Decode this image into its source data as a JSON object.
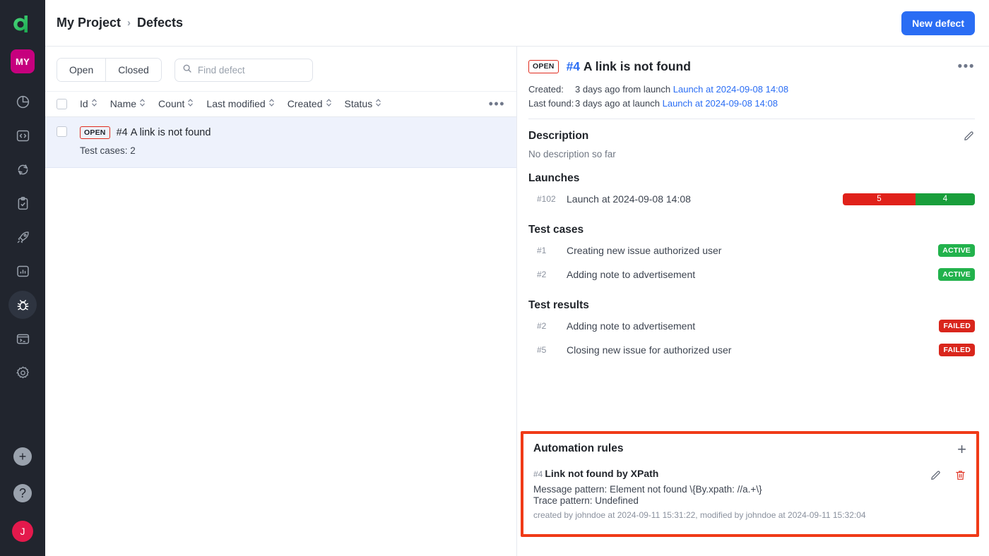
{
  "sidebar": {
    "logo": "allure-logo",
    "project_badge": "MY",
    "nav_items": [
      {
        "name": "dashboard",
        "icon": "pie-chart-icon",
        "active": false
      },
      {
        "name": "code",
        "icon": "code-brackets-icon",
        "active": false
      },
      {
        "name": "sync",
        "icon": "refresh-cycle-icon",
        "active": false
      },
      {
        "name": "test-plan",
        "icon": "clipboard-check-icon",
        "active": false
      },
      {
        "name": "launches",
        "icon": "rocket-icon",
        "active": false
      },
      {
        "name": "analytics",
        "icon": "bar-chart-icon",
        "active": false
      },
      {
        "name": "defects",
        "icon": "bug-icon",
        "active": true
      },
      {
        "name": "console",
        "icon": "terminal-icon",
        "active": false
      },
      {
        "name": "settings",
        "icon": "gear-icon",
        "active": false
      }
    ],
    "add_label": "+",
    "help_label": "?",
    "avatar_initial": "J"
  },
  "topbar": {
    "breadcrumb": {
      "project": "My Project",
      "separator": "›",
      "current": "Defects"
    },
    "new_defect_label": "New defect"
  },
  "list_pane": {
    "tabs": [
      {
        "label": "Open",
        "selected": true
      },
      {
        "label": "Closed",
        "selected": false
      }
    ],
    "search": {
      "placeholder": "Find defect",
      "value": "",
      "icon": "search-icon"
    },
    "columns": [
      {
        "label": "Id"
      },
      {
        "label": "Name"
      },
      {
        "label": "Count"
      },
      {
        "label": "Last modified"
      },
      {
        "label": "Created"
      },
      {
        "label": "Status"
      }
    ],
    "more_label": "•••",
    "rows": [
      {
        "status_tag": "OPEN",
        "id": "#4",
        "title": "A link is not found",
        "subtitle": "Test cases: 2"
      }
    ]
  },
  "detail": {
    "status_tag": "OPEN",
    "id": "#4",
    "title": "A link is not found",
    "more_label": "•••",
    "meta": {
      "created_label": "Created:",
      "created_value": "3 days ago from launch",
      "created_link": "Launch at 2024-09-08 14:08",
      "last_found_label": "Last found:",
      "last_found_value": "3 days ago at launch",
      "last_found_link": "Launch at 2024-09-08 14:08"
    },
    "description": {
      "title": "Description",
      "text": "No description so far",
      "edit_icon": "pencil-icon"
    },
    "launches": {
      "title": "Launches",
      "items": [
        {
          "id": "#102",
          "name": "Launch at 2024-09-08 14:08",
          "failed_count": "5",
          "passed_count": "4",
          "failed_color": "#e0211a",
          "passed_color": "#199e3b"
        }
      ]
    },
    "test_cases": {
      "title": "Test cases",
      "items": [
        {
          "id": "#1",
          "name": "Creating new issue authorized user",
          "status": "ACTIVE"
        },
        {
          "id": "#2",
          "name": "Adding note to advertisement",
          "status": "ACTIVE"
        }
      ]
    },
    "test_results": {
      "title": "Test results",
      "items": [
        {
          "id": "#2",
          "name": "Adding note to advertisement",
          "status": "FAILED"
        },
        {
          "id": "#5",
          "name": "Closing new issue for authorized user",
          "status": "FAILED"
        }
      ]
    },
    "automation_rules": {
      "title": "Automation rules",
      "add_label": "+",
      "highlight_color": "#f03a17",
      "rule": {
        "id": "#4",
        "name": "Link not found by XPath",
        "message_pattern": "Message pattern: Element not found \\{By.xpath: //a.+\\}",
        "trace_pattern": "Trace pattern: Undefined",
        "footer": "created by johndoe at 2024-09-11 15:31:22, modified by johndoe at 2024-09-11 15:32:04",
        "edit_icon": "pencil-icon",
        "delete_icon": "trash-icon"
      }
    }
  },
  "colors": {
    "accent_blue": "#2a6df4",
    "sidebar_bg": "#21252e",
    "open_red": "#e02b1d",
    "highlight_red": "#f03a17",
    "badge_green": "#22b24c",
    "badge_red": "#d9261c",
    "project_pink": "#c6007e",
    "avatar_red": "#e4194c"
  }
}
